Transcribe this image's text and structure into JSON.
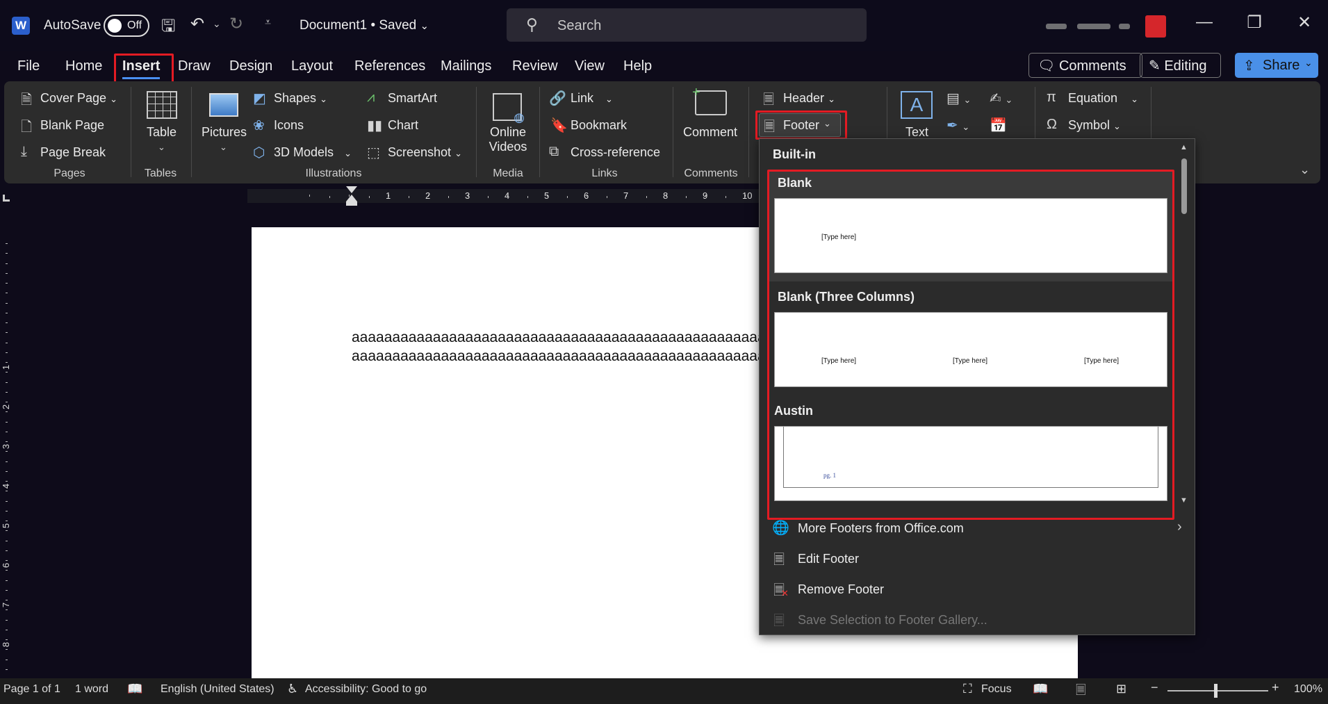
{
  "titlebar": {
    "app_icon": "W",
    "autosave_label": "AutoSave",
    "autosave_state": "Off",
    "document_title": "Document1 • Saved",
    "search_placeholder": "Search"
  },
  "menu": {
    "tabs": [
      "File",
      "Home",
      "Insert",
      "Draw",
      "Design",
      "Layout",
      "References",
      "Mailings",
      "Review",
      "View",
      "Help"
    ],
    "active_tab": "Insert",
    "comments_label": "Comments",
    "editing_label": "Editing",
    "share_label": "Share"
  },
  "ribbon": {
    "pages": {
      "group": "Pages",
      "cover_page": "Cover Page",
      "blank_page": "Blank Page",
      "page_break": "Page Break"
    },
    "tables": {
      "group": "Tables",
      "table": "Table"
    },
    "illustrations": {
      "group": "Illustrations",
      "pictures": "Pictures",
      "shapes": "Shapes",
      "icons": "Icons",
      "models": "3D Models",
      "smartart": "SmartArt",
      "chart": "Chart",
      "screenshot": "Screenshot"
    },
    "media": {
      "group": "Media",
      "online_videos_1": "Online",
      "online_videos_2": "Videos"
    },
    "links": {
      "group": "Links",
      "link": "Link",
      "bookmark": "Bookmark",
      "cross_reference": "Cross-reference"
    },
    "comments": {
      "group": "Comments",
      "comment": "Comment"
    },
    "header_footer": {
      "header": "Header",
      "footer": "Footer"
    },
    "text": {
      "text": "Text"
    },
    "symbols": {
      "equation": "Equation",
      "symbol": "Symbol"
    }
  },
  "ruler": {
    "numbers": [
      "1",
      "2",
      "3",
      "4",
      "5",
      "6",
      "7",
      "8",
      "9",
      "10"
    ],
    "v_numbers": [
      "1",
      "2",
      "3",
      "4",
      "5",
      "6",
      "7",
      "8"
    ]
  },
  "document": {
    "line1": "aaaaaaaaaaaaaaaaaaaaaaaaaaaaaaaaaaaaaaaaaaaaaaaaaaaaaaaaaa",
    "line2": "aaaaaaaaaaaaaaaaaaaaaaaaaaaaaaaaaaaaaaaaaaaaaaaaaaaaaaaaaa"
  },
  "footer_dropdown": {
    "section_title": "Built-in",
    "items": [
      {
        "title": "Blank",
        "placeholders": [
          "[Type here]"
        ]
      },
      {
        "title": "Blank (Three Columns)",
        "placeholders": [
          "[Type here]",
          "[Type here]",
          "[Type here]"
        ]
      },
      {
        "title": "Austin",
        "placeholders": [
          "pg. 1"
        ]
      }
    ],
    "menu": {
      "more": "More Footers from Office.com",
      "edit": "Edit Footer",
      "remove": "Remove Footer",
      "save_selection": "Save Selection to Footer Gallery..."
    }
  },
  "statusbar": {
    "page": "Page 1 of 1",
    "words": "1 word",
    "language": "English (United States)",
    "accessibility": "Accessibility: Good to go",
    "focus": "Focus",
    "zoom": "100%"
  }
}
